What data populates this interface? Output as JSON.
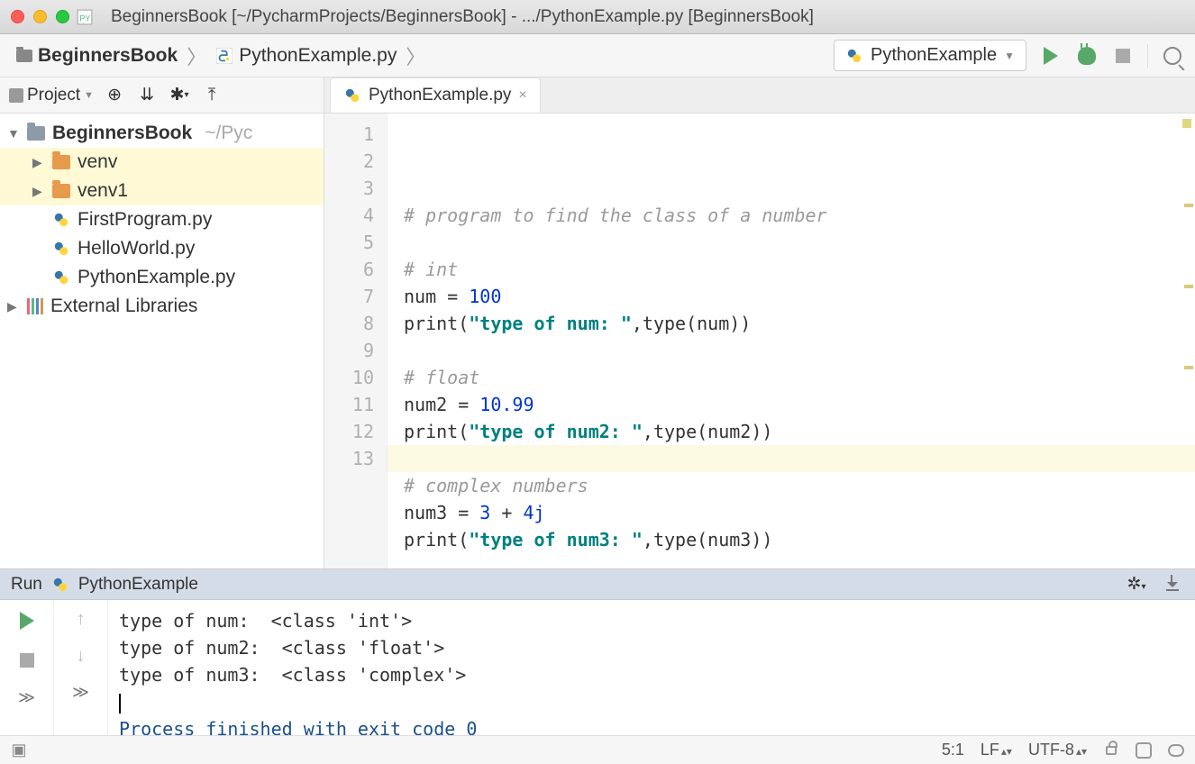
{
  "titlebar": {
    "title": "BeginnersBook [~/PycharmProjects/BeginnersBook] - .../PythonExample.py [BeginnersBook]"
  },
  "breadcrumbs": {
    "project": "BeginnersBook",
    "file": "PythonExample.py"
  },
  "runConfig": {
    "selected": "PythonExample"
  },
  "sidebar": {
    "projectLabel": "Project",
    "root": {
      "name": "BeginnersBook",
      "path": "~/Pyc"
    },
    "items": [
      {
        "name": "venv",
        "type": "folder"
      },
      {
        "name": "venv1",
        "type": "folder"
      },
      {
        "name": "FirstProgram.py",
        "type": "py"
      },
      {
        "name": "HelloWorld.py",
        "type": "py"
      },
      {
        "name": "PythonExample.py",
        "type": "py"
      }
    ],
    "external": "External Libraries"
  },
  "editor": {
    "tabName": "PythonExample.py",
    "lines": [
      {
        "n": "1",
        "html": "<span class='cmt'># program to find the class of a number</span>"
      },
      {
        "n": "2",
        "html": ""
      },
      {
        "n": "3",
        "html": "<span class='cmt'># int</span>"
      },
      {
        "n": "4",
        "html": "num = <span class='num'>100</span>"
      },
      {
        "n": "5",
        "html": "print(<span class='str'>\"type of num: \"</span>,type(num))"
      },
      {
        "n": "6",
        "html": ""
      },
      {
        "n": "7",
        "html": "<span class='cmt'># float</span>"
      },
      {
        "n": "8",
        "html": "num2 = <span class='num'>10.99</span>"
      },
      {
        "n": "9",
        "html": "print(<span class='str'>\"type of num2: \"</span>,type(num2))"
      },
      {
        "n": "10",
        "html": "",
        "hl": true
      },
      {
        "n": "11",
        "html": "<span class='cmt'># complex numbers</span>"
      },
      {
        "n": "12",
        "html": "num3 = <span class='num'>3</span> + <span class='num'>4j</span>"
      },
      {
        "n": "13",
        "html": "print(<span class='str'>\"type of num3: \"</span>,type(num3))"
      }
    ]
  },
  "runPanel": {
    "label": "Run",
    "configName": "PythonExample",
    "output": [
      "type of num:  <class 'int'>",
      "type of num2:  <class 'float'>",
      "type of num3:  <class 'complex'>",
      "",
      "Process finished with exit code 0"
    ]
  },
  "statusbar": {
    "pos": "5:1",
    "lineSep": "LF",
    "encoding": "UTF-8"
  }
}
